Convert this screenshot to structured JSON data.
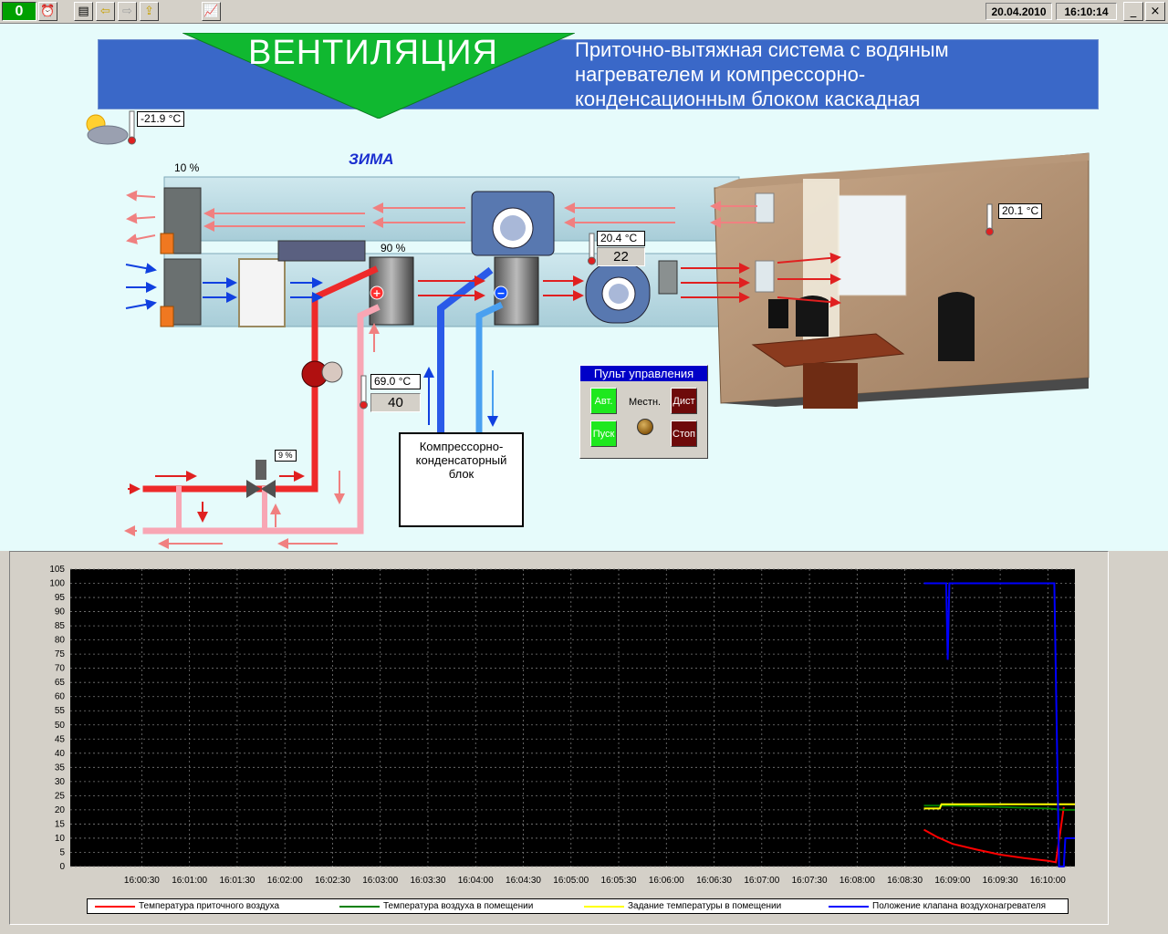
{
  "toolbar": {
    "alarm_count": "0",
    "date": "20.04.2010",
    "time": "16:10:14",
    "minimize": "_",
    "close": "×",
    "icons": [
      "alarm-clock-icon",
      "tree-view-icon",
      "back-arrow-icon",
      "forward-arrow-icon",
      "home-icon",
      "trend-icon"
    ]
  },
  "mimic": {
    "title": "ВЕНТИЛЯЦИЯ",
    "subtitle_lines": [
      "Приточно-вытяжная система с водяным",
      "нагревателем и компрессорно-",
      "конденсационным блоком каскадная"
    ],
    "outdoor_temp": "-21.9 °C",
    "season_mode": "ЗИМА",
    "damper_position": "10 %",
    "heater_valve_percent": "90 %",
    "supply_temp": "20.4 °C",
    "supply_setpoint": "22",
    "room_temp": "20.1 °C",
    "water_temp": "69.0 °C",
    "water_setpoint": "40",
    "three_way_valve": "9 %",
    "compressor_lines": [
      "Компрессорно-",
      "конденсаторный",
      "блок"
    ]
  },
  "control_panel": {
    "title": "Пульт управления",
    "auto": "Авт.",
    "start": "Пуск",
    "local": "Местн.",
    "remote": "Дист",
    "stop": "Стоп"
  },
  "colors": {
    "supply_air": "#e02020",
    "exhaust_air": "#f08080",
    "intake_air": "#1040e0",
    "hot_water": "#ee2a2a",
    "return_water": "#f8a6b4",
    "chart_bg": "#000000"
  },
  "chart_data": {
    "type": "line",
    "y_ticks": [
      "105",
      "100",
      "95",
      "90",
      "85",
      "80",
      "75",
      "70",
      "65",
      "60",
      "55",
      "50",
      "45",
      "40",
      "35",
      "30",
      "25",
      "20",
      "15",
      "10",
      "5",
      "0"
    ],
    "x_ticks": [
      "16:00:30",
      "16:01:00",
      "16:01:30",
      "16:02:00",
      "16:02:30",
      "16:03:00",
      "16:03:30",
      "16:04:00",
      "16:04:30",
      "16:05:00",
      "16:05:30",
      "16:06:00",
      "16:06:30",
      "16:07:00",
      "16:07:30",
      "16:08:00",
      "16:08:30",
      "16:09:00",
      "16:09:30",
      "16:10:00"
    ],
    "ylim": [
      0,
      105
    ],
    "grid": true,
    "series": [
      {
        "name": "Температура приточного воздуха",
        "color": "#ff0000",
        "points": [
          [
            "16:08:42",
            13
          ],
          [
            "16:08:50",
            10.5
          ],
          [
            "16:09:00",
            8
          ],
          [
            "16:09:15",
            6
          ],
          [
            "16:09:30",
            4.2
          ],
          [
            "16:09:45",
            3
          ],
          [
            "16:10:00",
            2
          ],
          [
            "16:10:05",
            1.5
          ],
          [
            "16:10:08",
            13
          ],
          [
            "16:10:10",
            21
          ]
        ]
      },
      {
        "name": "Температура воздуха в помещении",
        "color": "#008000",
        "points": [
          [
            "16:08:42",
            21.5
          ],
          [
            "16:09:00",
            21.5
          ],
          [
            "16:09:30",
            21
          ],
          [
            "16:10:00",
            20.5
          ],
          [
            "16:10:10",
            20
          ],
          [
            "16:10:17",
            20
          ]
        ]
      },
      {
        "name": "Задание температуры в помещении",
        "color": "#ffff00",
        "points": [
          [
            "16:08:42",
            20.5
          ],
          [
            "16:08:52",
            20.5
          ],
          [
            "16:08:53",
            22
          ],
          [
            "16:09:30",
            22
          ],
          [
            "16:10:00",
            22
          ],
          [
            "16:10:17",
            22
          ]
        ]
      },
      {
        "name": "Положение клапана воздухонагревателя",
        "color": "#0000ff",
        "points": [
          [
            "16:08:42",
            100
          ],
          [
            "16:08:56",
            100
          ],
          [
            "16:08:57",
            73
          ],
          [
            "16:08:58",
            100
          ],
          [
            "16:10:04",
            100
          ],
          [
            "16:10:07",
            0
          ],
          [
            "16:10:10",
            0
          ],
          [
            "16:10:11",
            10
          ],
          [
            "16:10:14",
            10
          ],
          [
            "16:10:17",
            10
          ]
        ]
      }
    ]
  }
}
